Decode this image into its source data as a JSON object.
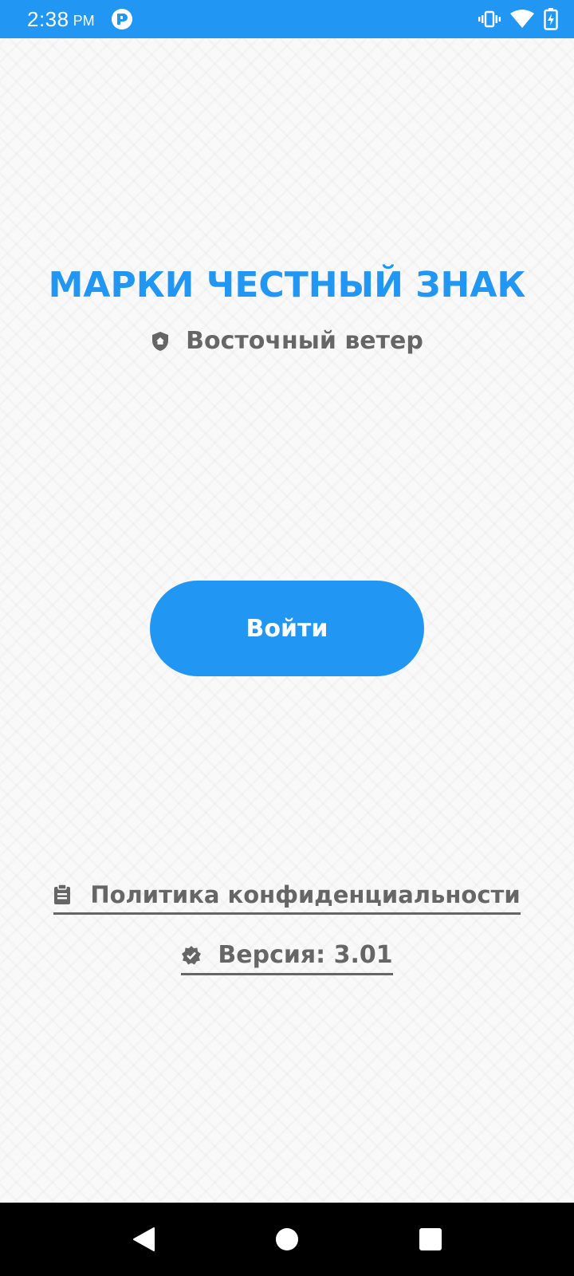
{
  "status_bar": {
    "time": "2:38",
    "ampm": "PM",
    "icons": [
      "app-notification-icon",
      "vibrate-icon",
      "wifi-icon",
      "battery-charging-icon"
    ],
    "color": "#2196f3"
  },
  "main": {
    "title": "МАРКИ ЧЕСТНЫЙ ЗНАК",
    "organization": {
      "icon": "shield-home-icon",
      "name": "Восточный ветер"
    },
    "login_button": {
      "label": "Войти",
      "color": "#2196f3"
    },
    "privacy_link": {
      "icon": "clipboard-icon",
      "label": "Политика конфиденциальности"
    },
    "version": {
      "icon": "verified-badge-icon",
      "label": "Версия: 3.01"
    }
  },
  "nav_bar": {
    "buttons": [
      "back-icon",
      "home-icon",
      "recents-icon"
    ]
  }
}
